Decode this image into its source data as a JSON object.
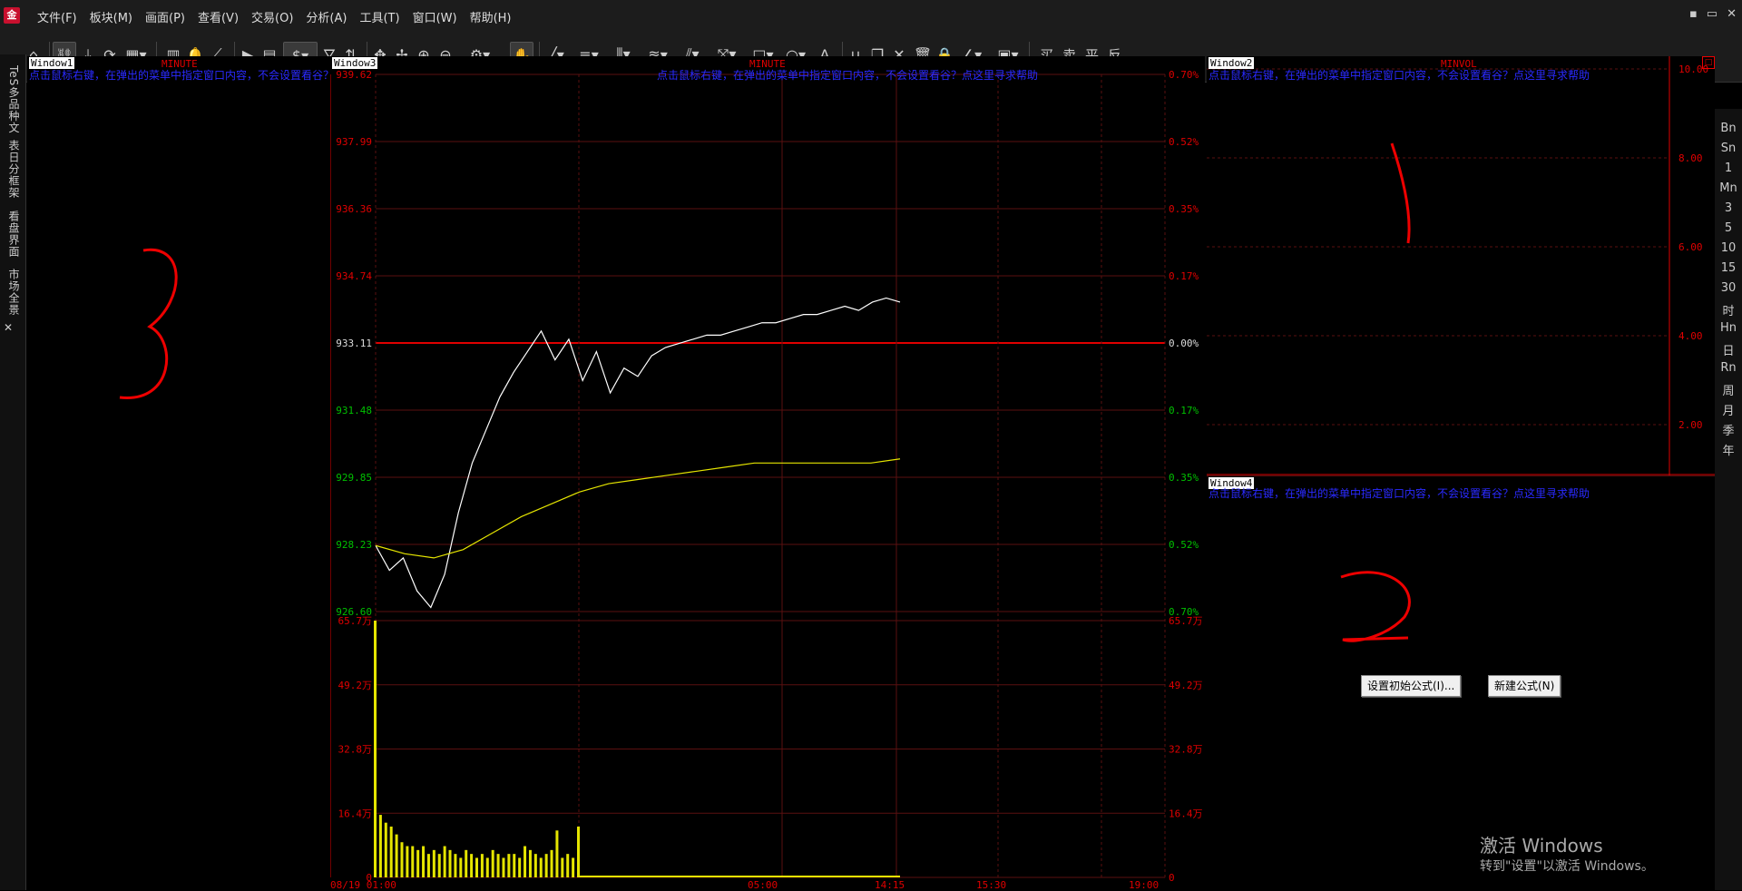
{
  "menu": [
    "文件(F)",
    "板块(M)",
    "画面(P)",
    "查看(V)",
    "交易(O)",
    "分析(A)",
    "工具(T)",
    "窗口(W)",
    "帮助(H)"
  ],
  "toolbar_text": [
    "买",
    "卖",
    "平",
    "反"
  ],
  "window_controls": [
    "▪",
    "▭",
    "✕"
  ],
  "left_tabs": [
    "TeS多品种文",
    "表日分框架",
    "看盘界面",
    "市场全景"
  ],
  "right_periods": [
    "Bn",
    "Sn",
    "1",
    "Mn",
    "3",
    "5",
    "10",
    "15",
    "30",
    "时",
    "Hn",
    "日",
    "Rn",
    "周",
    "月",
    "季",
    "年"
  ],
  "window1": {
    "tag": "Window1",
    "type": "MINUTE",
    "hint": "点击鼠标右键，在弹出的菜单中指定窗口内容，不会设置看谷？点这里寻求帮助"
  },
  "window3": {
    "tag": "Window3",
    "type": "MINUTE",
    "hint": "点击鼠标右键，在弹出的菜单中指定窗口内容，不会设置看谷？点这里寻求帮助",
    "price_ticks": [
      "939.62",
      "937.99",
      "936.36",
      "934.74",
      "933.11",
      "931.48",
      "929.85",
      "928.23",
      "926.60"
    ],
    "pct_ticks": [
      "0.70%",
      "0.52%",
      "0.35%",
      "0.17%",
      "0.00%",
      "0.17%",
      "0.35%",
      "0.52%",
      "0.70%"
    ],
    "vol_ticks": [
      "65.7万",
      "49.2万",
      "32.8万",
      "16.4万",
      "0"
    ],
    "time_ticks": [
      "08/19 01:00",
      "05:00",
      "14:15",
      "15:30",
      "19:00"
    ]
  },
  "window2": {
    "tag": "Window2",
    "type": "MINVOL",
    "hint": "点击鼠标右键，在弹出的菜单中指定窗口内容，不会设置看谷？点这里寻求帮助",
    "ticks": [
      "10.00",
      "8.00",
      "6.00",
      "4.00",
      "2.00"
    ]
  },
  "window4": {
    "tag": "Window4",
    "hint": "点击鼠标右键，在弹出的菜单中指定窗口内容，不会设置看谷？点这里寻求帮助",
    "btn_init": "设置初始公式(I)...",
    "btn_new": "新建公式(N)"
  },
  "annotations": [
    "3",
    "1",
    "2"
  ],
  "watermark": {
    "line1": "激活 Windows",
    "line2": "转到\"设置\"以激活 Windows。"
  },
  "chart_data": {
    "type": "line",
    "title": "",
    "xlabel": "",
    "ylabel": "",
    "ylim": [
      926.6,
      939.62
    ],
    "series": [
      {
        "values": [
          928.2,
          927.6,
          927.9,
          927.1,
          926.7,
          927.5,
          929.0,
          930.2,
          931.0,
          931.8,
          932.4,
          932.9,
          933.4,
          932.7,
          933.2,
          932.2,
          932.9,
          931.9,
          932.5,
          932.3,
          932.8,
          933.0,
          933.1,
          933.2,
          933.3,
          933.3,
          933.4,
          933.5,
          933.6,
          933.6,
          933.7,
          933.8,
          933.8,
          933.9,
          934.0,
          933.9,
          934.1,
          934.2,
          934.1
        ]
      },
      {
        "values": [
          928.2,
          928.0,
          927.9,
          928.1,
          928.5,
          928.9,
          929.2,
          929.5,
          929.7,
          929.8,
          929.9,
          930.0,
          930.1,
          930.2,
          930.2,
          930.2,
          930.2,
          930.2,
          930.3
        ]
      }
    ],
    "volume_ylim": [
      0,
      65.7
    ],
    "volume": [
      65.7,
      16,
      14,
      13,
      11,
      9,
      8,
      8,
      7,
      8,
      6,
      7,
      6,
      8,
      7,
      6,
      5,
      7,
      6,
      5,
      6,
      5,
      7,
      6,
      5,
      6,
      6,
      5,
      8,
      7,
      6,
      5,
      6,
      7,
      12,
      5,
      6,
      5,
      13
    ]
  },
  "colors": {
    "red": "#e00000",
    "yellow": "#e5e500",
    "white": "#ffffff",
    "blue": "#2a2aff",
    "grid": "#5a1010",
    "green": "#00c000"
  }
}
